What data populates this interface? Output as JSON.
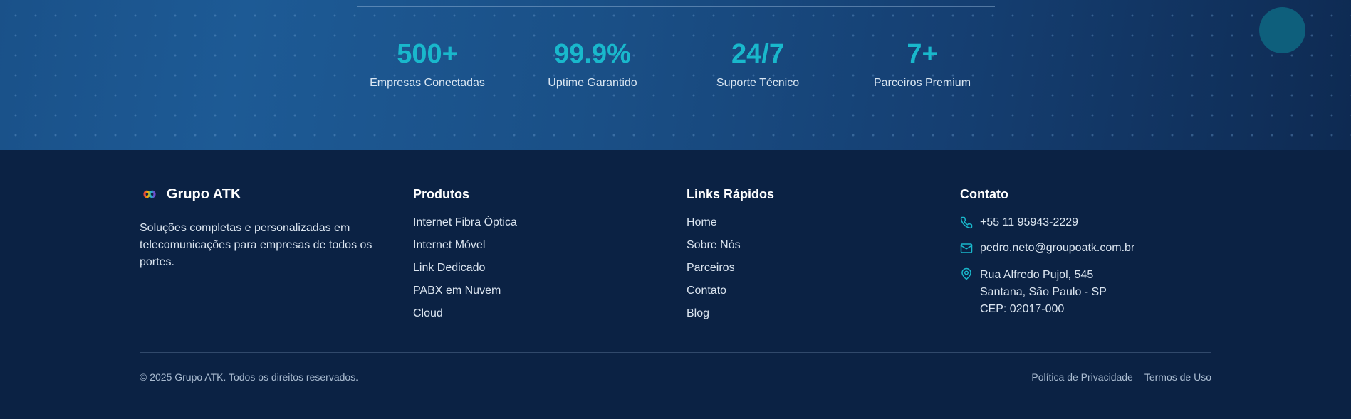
{
  "stats": [
    {
      "value": "500+",
      "label": "Empresas Conectadas"
    },
    {
      "value": "99.9%",
      "label": "Uptime Garantido"
    },
    {
      "value": "24/7",
      "label": "Suporte Técnico"
    },
    {
      "value": "7+",
      "label": "Parceiros Premium"
    }
  ],
  "brand": {
    "name": "Grupo ATK",
    "description": "Soluções completas e personalizadas em telecomunicações para empresas de todos os portes.",
    "logo_icon": "infinity-logo-icon"
  },
  "products": {
    "title": "Produtos",
    "items": [
      "Internet Fibra Óptica",
      "Internet Móvel",
      "Link Dedicado",
      "PABX em Nuvem",
      "Cloud"
    ]
  },
  "quick_links": {
    "title": "Links Rápidos",
    "items": [
      "Home",
      "Sobre Nós",
      "Parceiros",
      "Contato",
      "Blog"
    ]
  },
  "contact": {
    "title": "Contato",
    "phone": "+55 11 95943-2229",
    "email": "pedro.neto@groupoatk.com.br",
    "address": [
      "Rua Alfredo Pujol, 545",
      "Santana, São Paulo - SP",
      "CEP: 02017-000"
    ]
  },
  "footer_bottom": {
    "copyright": "© 2025 Grupo ATK. Todos os direitos reservados.",
    "privacy": "Política de Privacidade",
    "terms": "Termos de Uso"
  },
  "colors": {
    "accent": "#19b8cc",
    "footer_bg": "#0b2244",
    "band_bg": "#1a5189"
  }
}
